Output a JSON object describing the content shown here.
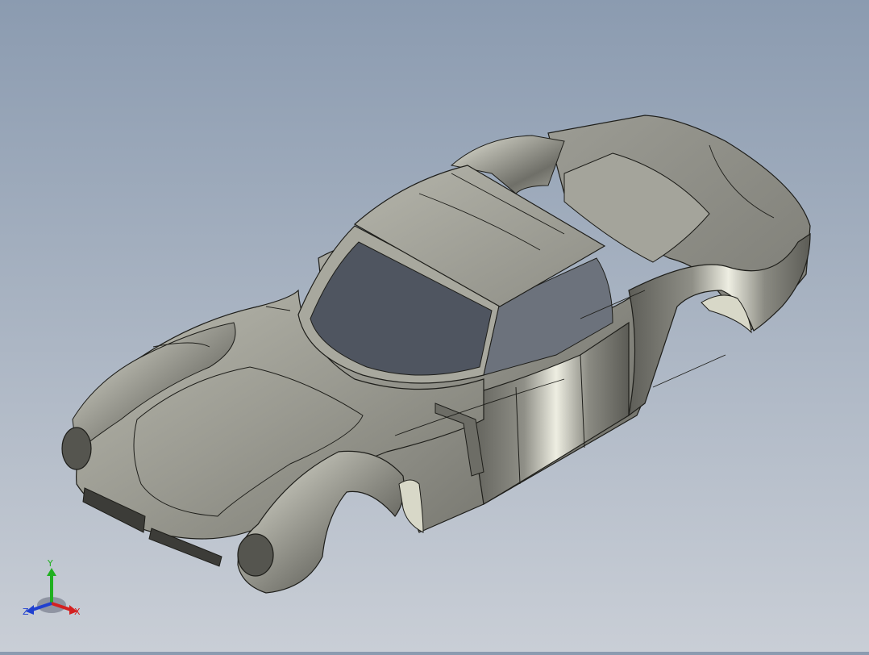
{
  "viewport": {
    "background_top": "#8b9bb0",
    "background_bottom": "#c9ced6",
    "model_name": "car-body-shell"
  },
  "triad": {
    "x_label": "X",
    "y_label": "Y",
    "z_label": "Z",
    "x_color": "#d42020",
    "y_color": "#20b020",
    "z_color": "#2040d0"
  }
}
